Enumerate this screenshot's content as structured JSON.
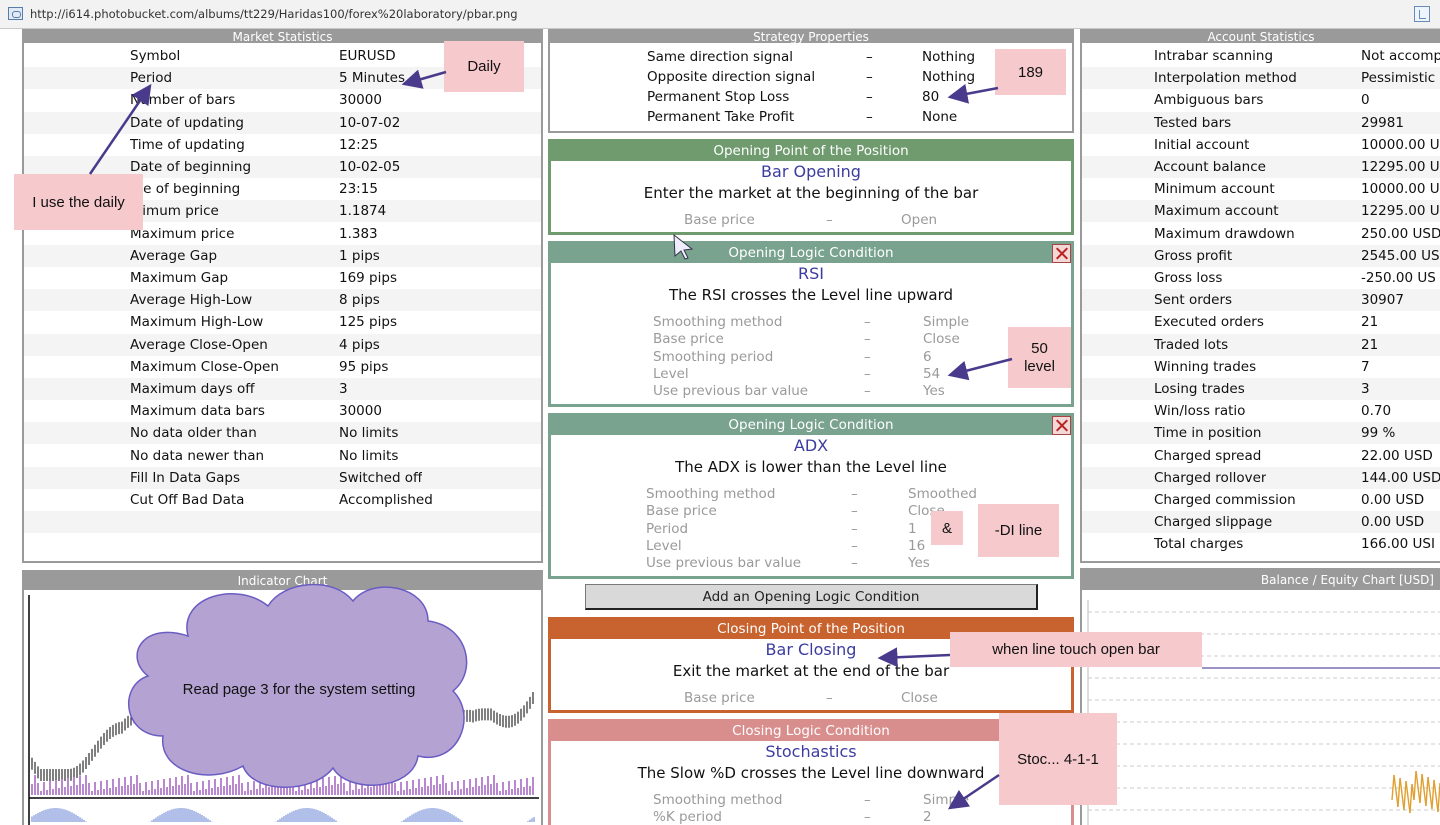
{
  "browser": {
    "url": "http://i614.photobucket.com/albums/tt229/Haridas100/forex%20laboratory/pbar.png"
  },
  "market_statistics": {
    "title": "Market Statistics",
    "rows": [
      {
        "label": "Symbol",
        "value": "EURUSD"
      },
      {
        "label": "Period",
        "value": "5 Minutes"
      },
      {
        "label": "Number of bars",
        "value": "30000"
      },
      {
        "label": "Date of updating",
        "value": "10-07-02"
      },
      {
        "label": "Time of updating",
        "value": "12:25"
      },
      {
        "label": "Date of beginning",
        "value": "10-02-05"
      },
      {
        "label": "me of beginning",
        "value": "23:15"
      },
      {
        "label": "inimum price",
        "value": "1.1874"
      },
      {
        "label": "Maximum price",
        "value": "1.383"
      },
      {
        "label": "Average Gap",
        "value": "1 pips"
      },
      {
        "label": "Maximum Gap",
        "value": "169 pips"
      },
      {
        "label": "Average High-Low",
        "value": "8 pips"
      },
      {
        "label": "Maximum High-Low",
        "value": "125 pips"
      },
      {
        "label": "Average Close-Open",
        "value": "4 pips"
      },
      {
        "label": "Maximum Close-Open",
        "value": "95 pips"
      },
      {
        "label": "Maximum days off",
        "value": "3"
      },
      {
        "label": "Maximum data bars",
        "value": "30000"
      },
      {
        "label": "No data older than",
        "value": "No limits"
      },
      {
        "label": "No data newer than",
        "value": "No limits"
      },
      {
        "label": "Fill In Data Gaps",
        "value": "Switched off"
      },
      {
        "label": "Cut Off Bad Data",
        "value": "Accomplished"
      }
    ]
  },
  "strategy_properties": {
    "title": "Strategy Properties",
    "rows": [
      {
        "label": "Same direction signal",
        "sep": "–",
        "value": "Nothing"
      },
      {
        "label": "Opposite direction signal",
        "sep": "–",
        "value": "Nothing"
      },
      {
        "label": "Permanent Stop Loss",
        "sep": "–",
        "value": "80"
      },
      {
        "label": "Permanent Take Profit",
        "sep": "–",
        "value": "None"
      }
    ]
  },
  "account_statistics": {
    "title": "Account Statistics",
    "rows": [
      {
        "label": "Intrabar scanning",
        "value": "Not accomp"
      },
      {
        "label": "Interpolation method",
        "value": "Pessimistic"
      },
      {
        "label": "Ambiguous bars",
        "value": "0"
      },
      {
        "label": "Tested bars",
        "value": "29981"
      },
      {
        "label": "Initial account",
        "value": "10000.00 U"
      },
      {
        "label": "Account balance",
        "value": "12295.00 U"
      },
      {
        "label": "Minimum account",
        "value": "10000.00 U"
      },
      {
        "label": "Maximum account",
        "value": "12295.00 U"
      },
      {
        "label": "Maximum drawdown",
        "value": "250.00 USD"
      },
      {
        "label": "Gross profit",
        "value": "2545.00 US"
      },
      {
        "label": "Gross loss",
        "value": "-250.00 US"
      },
      {
        "label": "Sent orders",
        "value": "30907"
      },
      {
        "label": "Executed orders",
        "value": "21"
      },
      {
        "label": "Traded lots",
        "value": "21"
      },
      {
        "label": "Winning trades",
        "value": "7"
      },
      {
        "label": "Losing trades",
        "value": "3"
      },
      {
        "label": "Win/loss ratio",
        "value": "0.70"
      },
      {
        "label": "Time in position",
        "value": "99 %"
      },
      {
        "label": "Charged spread",
        "value": "22.00 USD"
      },
      {
        "label": "Charged rollover",
        "value": "144.00 USD"
      },
      {
        "label": "Charged commission",
        "value": "0.00 USD"
      },
      {
        "label": "Charged slippage",
        "value": "0.00 USD"
      },
      {
        "label": "Total charges",
        "value": "166.00 USI"
      }
    ]
  },
  "opening_point": {
    "title": "Opening Point of the Position",
    "name": "Bar Opening",
    "description": "Enter the market at the beginning of the bar",
    "params": [
      {
        "label": "Base price",
        "sep": "–",
        "value": "Open"
      }
    ],
    "color": "#6f9b6f"
  },
  "opening_logic_1": {
    "title": "Opening Logic Condition",
    "name": "RSI",
    "description": "The RSI crosses the Level line upward",
    "params": [
      {
        "label": "Smoothing method",
        "sep": "–",
        "value": "Simple"
      },
      {
        "label": "Base price",
        "sep": "–",
        "value": "Close"
      },
      {
        "label": "Smoothing period",
        "sep": "–",
        "value": "6"
      },
      {
        "label": "Level",
        "sep": "–",
        "value": "54"
      },
      {
        "label": "Use previous bar value",
        "sep": "–",
        "value": "Yes"
      }
    ],
    "color": "#79a38f"
  },
  "opening_logic_2": {
    "title": "Opening Logic Condition",
    "name": "ADX",
    "description": "The ADX is lower than the Level line",
    "params": [
      {
        "label": "Smoothing method",
        "sep": "–",
        "value": "Smoothed"
      },
      {
        "label": "Base price",
        "sep": "–",
        "value": "Close"
      },
      {
        "label": "Period",
        "sep": "–",
        "value": "1"
      },
      {
        "label": "Level",
        "sep": "–",
        "value": "16"
      },
      {
        "label": "Use previous bar value",
        "sep": "–",
        "value": "Yes"
      }
    ],
    "color": "#79a38f"
  },
  "add_button": {
    "label": "Add an Opening Logic Condition"
  },
  "closing_point": {
    "title": "Closing Point of the Position",
    "name": "Bar Closing",
    "description": "Exit the market at the end of the bar",
    "params": [
      {
        "label": "Base price",
        "sep": "–",
        "value": "Close"
      }
    ],
    "color": "#c8622e"
  },
  "closing_logic": {
    "title": "Closing Logic Condition",
    "name": "Stochastics",
    "description": "The Slow %D crosses the Level line downward",
    "params": [
      {
        "label": "Smoothing method",
        "sep": "–",
        "value": "Simple"
      },
      {
        "label": "%K period",
        "sep": "–",
        "value": "2"
      }
    ],
    "color": "#d98e8e"
  },
  "indicator_chart": {
    "title": "Indicator Chart"
  },
  "balance_chart": {
    "title": "Balance / Equity Chart [USD]"
  },
  "annotations": {
    "daily": "Daily",
    "use_daily": "I use the daily",
    "stop_189": "189",
    "level_50": "50\nlevel",
    "amp": "&",
    "di_line": "-DI line",
    "line_touch": "when line touch open bar",
    "stoc": "Stoc... 4-1-1",
    "read_page": "Read page 3 for the system setting"
  }
}
